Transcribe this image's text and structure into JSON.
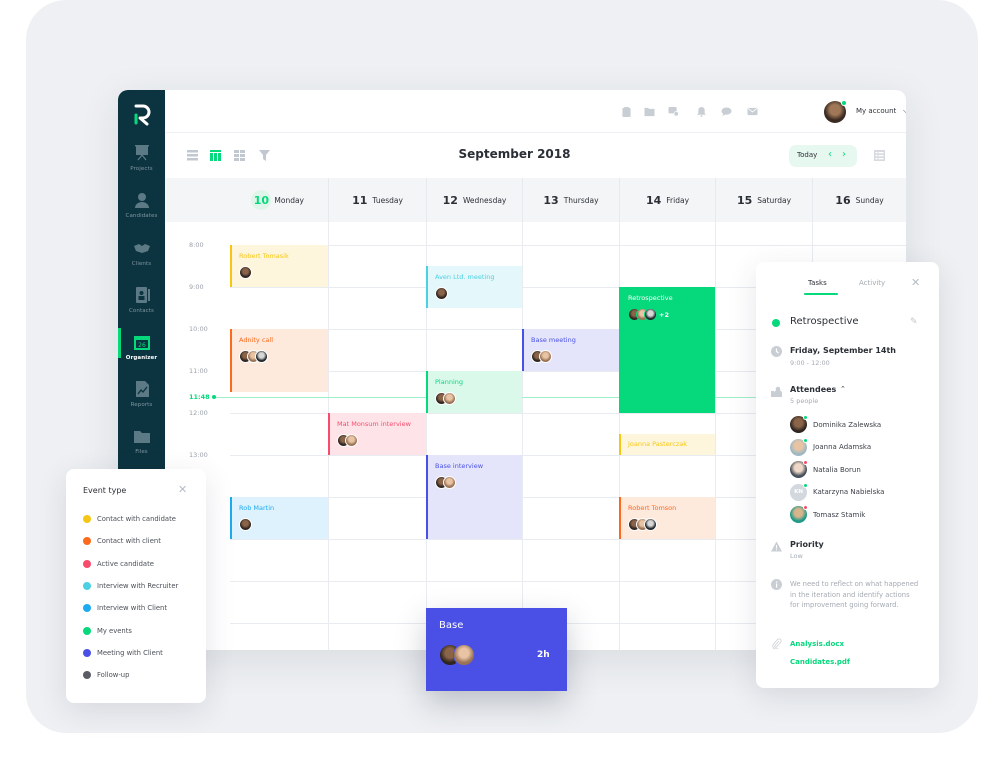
{
  "app": {
    "logo_letter": "R",
    "brand_color": "#06d97c",
    "sidebar_color": "#0c3340"
  },
  "sidebar": {
    "items": [
      {
        "label": "Projects",
        "icon": "presentation-board-icon",
        "active": false
      },
      {
        "label": "Candidates",
        "icon": "person-icon",
        "active": false
      },
      {
        "label": "Clients",
        "icon": "handshake-icon",
        "active": false
      },
      {
        "label": "Contacts",
        "icon": "address-book-icon",
        "active": false
      },
      {
        "label": "Organizer",
        "icon": "calendar-icon",
        "active": true,
        "badge": "26"
      },
      {
        "label": "Reports",
        "icon": "report-chart-icon",
        "active": false
      },
      {
        "label": "Files",
        "icon": "folder-icon",
        "active": false
      }
    ]
  },
  "topbar": {
    "icons": [
      "clipboard-icon",
      "folder-icon",
      "chat-check-icon",
      "bell-icon",
      "message-icon",
      "mail-icon"
    ],
    "account_label": "My account",
    "account_status": "online"
  },
  "toolbar": {
    "view_icons": [
      "list-view-icon",
      "week-view-icon",
      "month-view-icon",
      "filter-icon"
    ],
    "active_view": "week-view-icon",
    "month_title": "September 2018",
    "today_label": "Today",
    "prev_label": "‹",
    "next_label": "›"
  },
  "calendar": {
    "days": [
      {
        "num": "10",
        "name": "Monday",
        "today": true
      },
      {
        "num": "11",
        "name": "Tuesday",
        "today": false
      },
      {
        "num": "12",
        "name": "Wednesday",
        "today": false
      },
      {
        "num": "13",
        "name": "Thursday",
        "today": false
      },
      {
        "num": "14",
        "name": "Friday",
        "today": false
      },
      {
        "num": "15",
        "name": "Saturday",
        "today": false
      },
      {
        "num": "16",
        "name": "Sunday",
        "today": false
      }
    ],
    "hours": [
      "8:00",
      "9:00",
      "10:00",
      "11:00",
      "12:00",
      "13:00"
    ],
    "now_label": "11:48",
    "events": [
      {
        "title": "Robert Tomasik",
        "day": 0,
        "start": 8.0,
        "end": 9.0,
        "type": "Contact with candidate",
        "avatars": 1
      },
      {
        "title": "Adnity call",
        "day": 0,
        "start": 10.0,
        "end": 11.5,
        "type": "Contact with client",
        "avatars": 3
      },
      {
        "title": "Rob Martin",
        "day": 0,
        "start": 14.0,
        "end": 15.0,
        "type": "Interview with Client",
        "avatars": 1
      },
      {
        "title": "Mat Monsum interview",
        "day": 1,
        "start": 12.0,
        "end": 13.0,
        "type": "Active candidate",
        "avatars": 2
      },
      {
        "title": "Aven Ltd. meeting",
        "day": 2,
        "start": 8.5,
        "end": 9.5,
        "type": "Interview with Recruiter",
        "avatars": 1
      },
      {
        "title": "Planning",
        "day": 2,
        "start": 11.0,
        "end": 12.0,
        "type": "My events",
        "avatars": 2
      },
      {
        "title": "Base interview",
        "day": 2,
        "start": 13.0,
        "end": 15.0,
        "type": "Meeting with Client",
        "avatars": 2
      },
      {
        "title": "Base meeting",
        "day": 3,
        "start": 10.0,
        "end": 11.0,
        "type": "Meeting with Client",
        "avatars": 2
      },
      {
        "title": "Retrospective",
        "day": 4,
        "start": 9.0,
        "end": 12.0,
        "type": "My events",
        "avatars": 3,
        "more": "+2",
        "selected": true
      },
      {
        "title": "Joanna Pasterczak",
        "day": 4,
        "start": 12.5,
        "end": 13.0,
        "type": "Contact with candidate",
        "avatars": 0
      },
      {
        "title": "Robert Tomson",
        "day": 4,
        "start": 14.0,
        "end": 15.0,
        "type": "Contact with client",
        "avatars": 3
      }
    ]
  },
  "event_types": {
    "title": "Event type",
    "items": [
      {
        "label": "Contact with candidate",
        "color": "#f7c614"
      },
      {
        "label": "Contact with client",
        "color": "#fb6a1d"
      },
      {
        "label": "Active candidate",
        "color": "#f74c6b"
      },
      {
        "label": "Interview with Recruiter",
        "color": "#4dd0e1"
      },
      {
        "label": "Interview with Client",
        "color": "#1eaaf1"
      },
      {
        "label": "My events",
        "color": "#06d97c"
      },
      {
        "label": "Meeting with Client",
        "color": "#4a50e6"
      },
      {
        "label": "Follow-up",
        "color": "#5a5d63"
      }
    ]
  },
  "drag_card": {
    "title": "Base",
    "duration": "2h",
    "avatars": 2
  },
  "detail": {
    "tabs": [
      {
        "label": "Tasks",
        "active": true
      },
      {
        "label": "Activity",
        "active": false
      }
    ],
    "title": "Retrospective",
    "date": "Friday, September 14th",
    "time": "9:00 - 12:00",
    "attendees_label": "Attendees",
    "attendees_count": "5 people",
    "attendees": [
      {
        "name": "Dominika Zalewska",
        "status": "online",
        "initials": ""
      },
      {
        "name": "Joanna Adamska",
        "status": "online",
        "initials": ""
      },
      {
        "name": "Natalia Borun",
        "status": "busy",
        "initials": ""
      },
      {
        "name": "Katarzyna Nabielska",
        "status": "online",
        "initials": "KN"
      },
      {
        "name": "Tomasz Stamik",
        "status": "busy",
        "initials": ""
      }
    ],
    "priority_label": "Priority",
    "priority_value": "Low",
    "description": "We need to reflect on what happened in the iteration and identify actions for improvement going forward.",
    "attachments": [
      "Analysis.docx",
      "Candidates.pdf"
    ]
  }
}
